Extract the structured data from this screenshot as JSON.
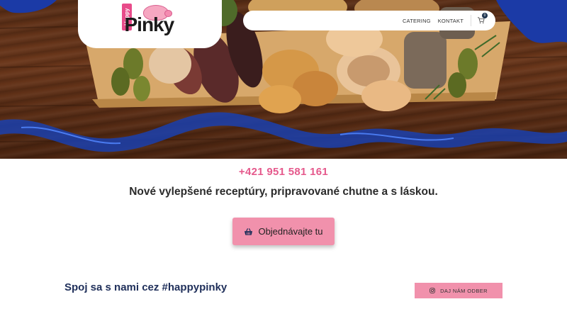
{
  "header": {
    "logo_small": "Happy",
    "logo_main": "Pinky",
    "nav": [
      {
        "label": "CATERING"
      },
      {
        "label": "KONTAKT"
      }
    ],
    "cart_count": "0"
  },
  "main": {
    "phone": "+421 951 581 161",
    "tagline": "Nové vylepšené receptúry, pripravované chutne a s láskou.",
    "order_button": "Objednávajte tu",
    "connect_title": "Spoj sa s nami cez #happypinky",
    "subscribe_button": "DAJ NÁM ODBER"
  },
  "colors": {
    "accent_pink": "#f191ac",
    "phone_pink": "#e5598c",
    "navy": "#1f2f5a"
  },
  "icons": {
    "cart": "cart-icon",
    "basket": "basket-icon",
    "instagram": "instagram-icon"
  }
}
